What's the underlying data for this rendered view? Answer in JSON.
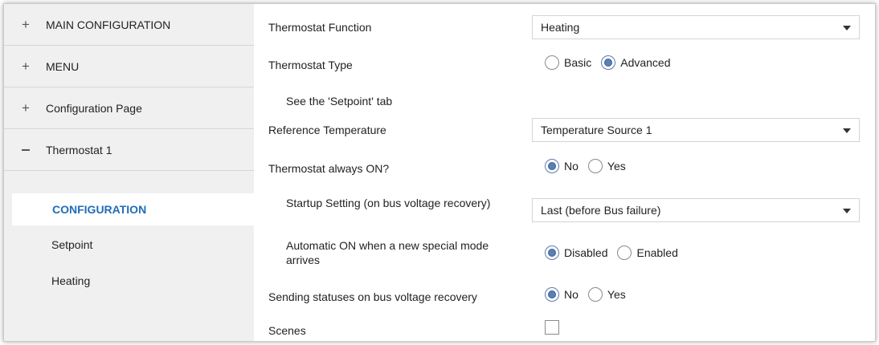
{
  "sidebar": {
    "groups": [
      {
        "sign": "+",
        "label": "MAIN CONFIGURATION"
      },
      {
        "sign": "+",
        "label": "MENU"
      },
      {
        "sign": "+",
        "label": "Configuration Page"
      },
      {
        "sign": "−",
        "label": "Thermostat 1"
      }
    ],
    "subitems": [
      {
        "label": "CONFIGURATION",
        "active": true
      },
      {
        "label": "Setpoint"
      },
      {
        "label": "Heating"
      }
    ]
  },
  "main": {
    "thermostat_function": {
      "label": "Thermostat Function",
      "value": "Heating"
    },
    "thermostat_type": {
      "label": "Thermostat Type",
      "options": [
        "Basic",
        "Advanced"
      ],
      "selected": "Advanced"
    },
    "setpoint_note": "See the 'Setpoint' tab",
    "reference_temperature": {
      "label": "Reference Temperature",
      "value": "Temperature Source 1"
    },
    "always_on": {
      "label": "Thermostat always ON?",
      "options": [
        "No",
        "Yes"
      ],
      "selected": "No"
    },
    "startup_setting": {
      "label": "Startup Setting (on bus voltage recovery)",
      "value": "Last (before Bus failure)"
    },
    "automatic_on": {
      "label": "Automatic ON when a new special mode arrives",
      "options": [
        "Disabled",
        "Enabled"
      ],
      "selected": "Disabled"
    },
    "sending_statuses": {
      "label": "Sending statuses on bus voltage recovery",
      "options": [
        "No",
        "Yes"
      ],
      "selected": "No"
    },
    "scenes": {
      "label": "Scenes",
      "checked": false
    }
  },
  "colors": {
    "accent": "#1f6db7",
    "sidebar_bg": "#f0f0f0",
    "radio_fill": "#5b7fb6"
  }
}
